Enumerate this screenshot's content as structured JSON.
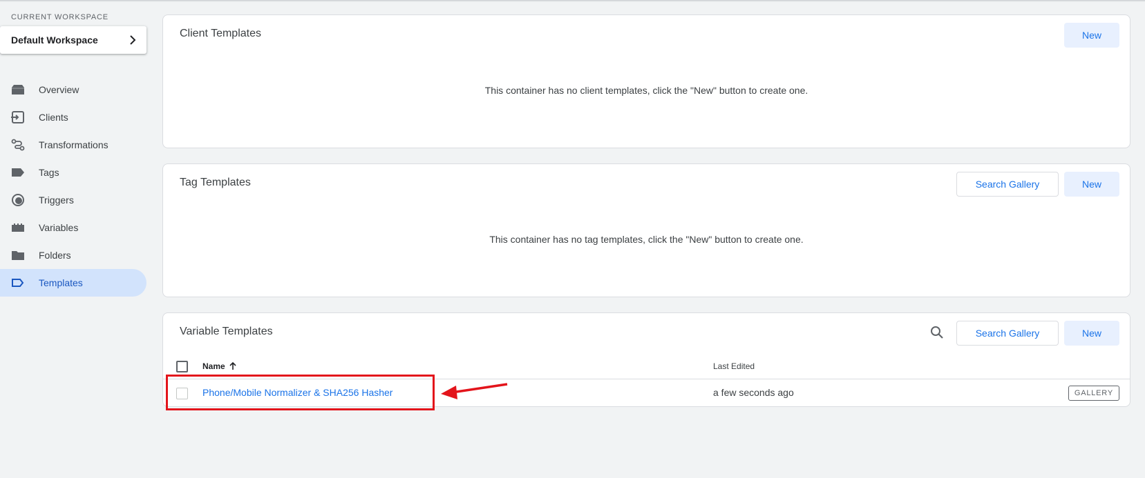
{
  "sidebar": {
    "workspace_label": "CURRENT WORKSPACE",
    "workspace_name": "Default Workspace",
    "items": [
      {
        "label": "Overview",
        "icon": "overview-icon"
      },
      {
        "label": "Clients",
        "icon": "clients-icon"
      },
      {
        "label": "Transformations",
        "icon": "transformations-icon"
      },
      {
        "label": "Tags",
        "icon": "tag-icon"
      },
      {
        "label": "Triggers",
        "icon": "triggers-icon"
      },
      {
        "label": "Variables",
        "icon": "variables-icon"
      },
      {
        "label": "Folders",
        "icon": "folder-icon"
      },
      {
        "label": "Templates",
        "icon": "templates-icon",
        "active": true
      }
    ]
  },
  "client_templates": {
    "title": "Client Templates",
    "new_label": "New",
    "empty_message": "This container has no client templates, click the \"New\" button to create one."
  },
  "tag_templates": {
    "title": "Tag Templates",
    "gallery_label": "Search Gallery",
    "new_label": "New",
    "empty_message": "This container has no tag templates, click the \"New\" button to create one."
  },
  "variable_templates": {
    "title": "Variable Templates",
    "gallery_label": "Search Gallery",
    "new_label": "New",
    "columns": {
      "name": "Name",
      "last_edited": "Last Edited"
    },
    "rows": [
      {
        "name": "Phone/Mobile Normalizer & SHA256 Hasher",
        "last_edited": "a few seconds ago",
        "badge": "GALLERY"
      }
    ]
  },
  "colors": {
    "accent": "#1a73e8",
    "active_nav_bg": "#d2e3fc",
    "annotation": "#e3141b"
  }
}
